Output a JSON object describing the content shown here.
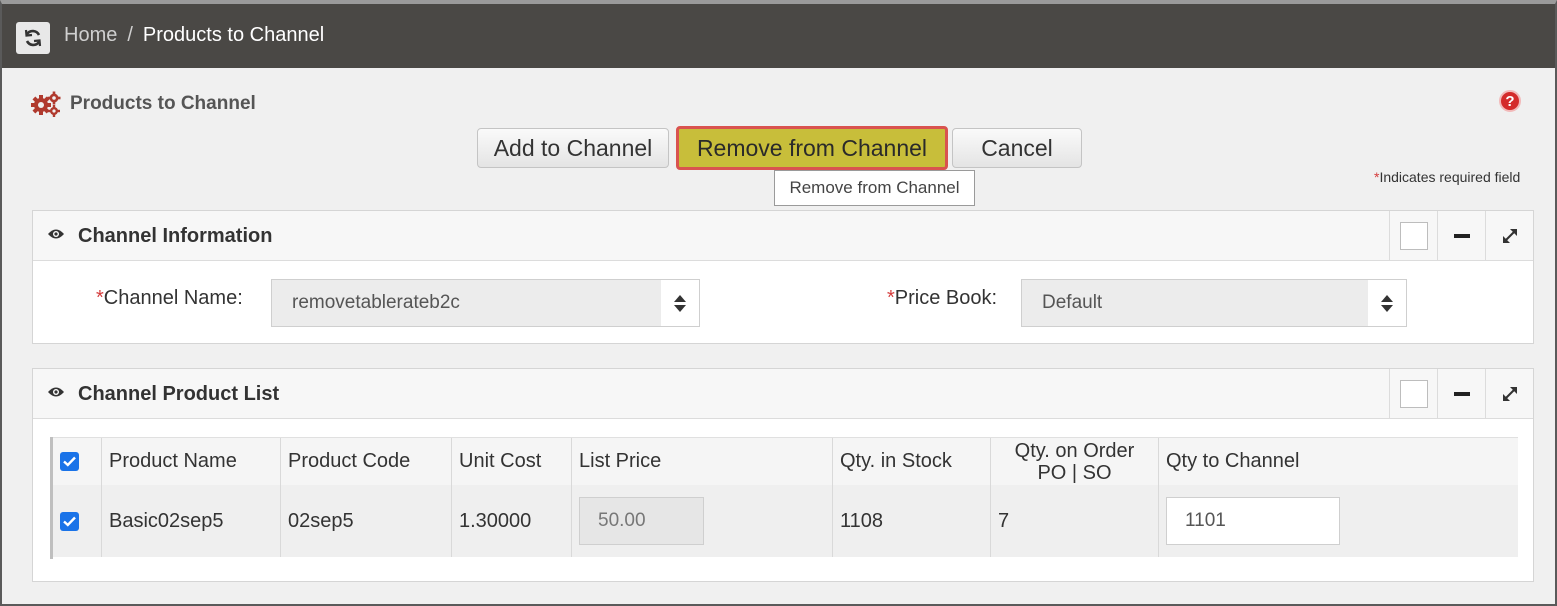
{
  "breadcrumb": {
    "home": "Home",
    "separator": "/",
    "current": "Products to Channel"
  },
  "page": {
    "title": "Products to Channel",
    "help_icon": "?"
  },
  "toolbar": {
    "add_label": "Add to Channel",
    "remove_label": "Remove from Channel",
    "cancel_label": "Cancel",
    "tooltip": "Remove from Channel"
  },
  "required_note": {
    "star": "*",
    "text": "Indicates required field"
  },
  "channel_info": {
    "title": "Channel Information",
    "channel_name_label": "Channel Name:",
    "channel_name_value": "removetablerateb2c",
    "price_book_label": "Price Book:",
    "price_book_value": "Default",
    "required_star": "*"
  },
  "product_list": {
    "title": "Channel Product List",
    "columns": [
      "Product Name",
      "Product Code",
      "Unit Cost",
      "List Price",
      "Qty. in Stock",
      "Qty. on Order",
      "PO | SO",
      "Qty to Channel"
    ],
    "rows": [
      {
        "product_name": "Basic02sep5",
        "product_code": "02sep5",
        "unit_cost": "1.30000",
        "list_price": "50.00",
        "qty_in_stock": "1108",
        "qty_on_order": "7",
        "qty_to_channel": "1101"
      }
    ]
  },
  "colors": {
    "topbar": "#4a4845",
    "highlight_button": "#c8be3a",
    "highlight_border": "#d9534f",
    "checkbox": "#1a73e8"
  }
}
